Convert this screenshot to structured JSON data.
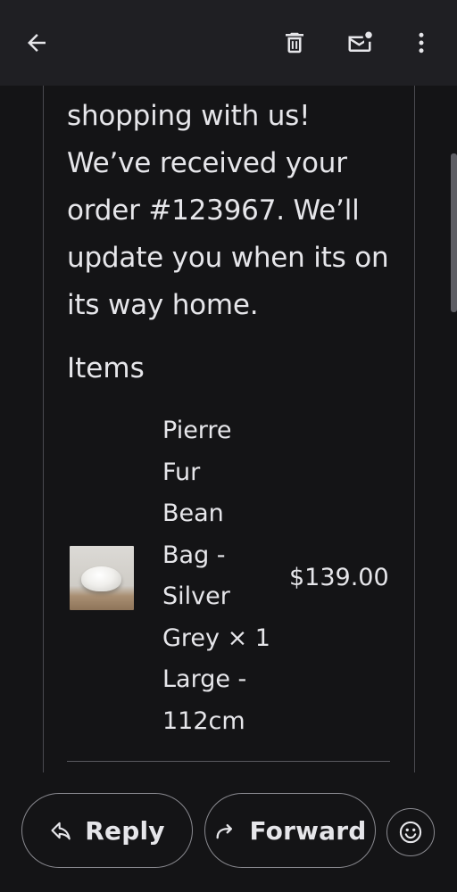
{
  "app_bar": {
    "back_icon": "arrow-left-icon",
    "delete_icon": "trash-icon",
    "unread_icon": "mark-unread-icon",
    "more_icon": "more-vertical-icon"
  },
  "email": {
    "message_lines": [
      "shopping with us!",
      "We’ve received your",
      "order #123967. We’ll",
      "update you when its on",
      "its way home."
    ],
    "items_heading": "Items",
    "item": {
      "name_lines": [
        "Pierre",
        "Fur",
        "Bean",
        "Bag -",
        "Silver",
        "Grey × 1",
        "Large -",
        "112cm"
      ],
      "price": "$139.00"
    }
  },
  "bottom_bar": {
    "reply_label": "Reply",
    "forward_label": "Forward",
    "reply_icon": "reply-arrow-icon",
    "forward_icon": "forward-arrow-icon",
    "emoji_icon": "smiley-icon"
  },
  "colors": {
    "background": "#141416",
    "app_bar": "#1f1f23",
    "text": "#e6e6ea",
    "outline": "#8a8a90"
  }
}
